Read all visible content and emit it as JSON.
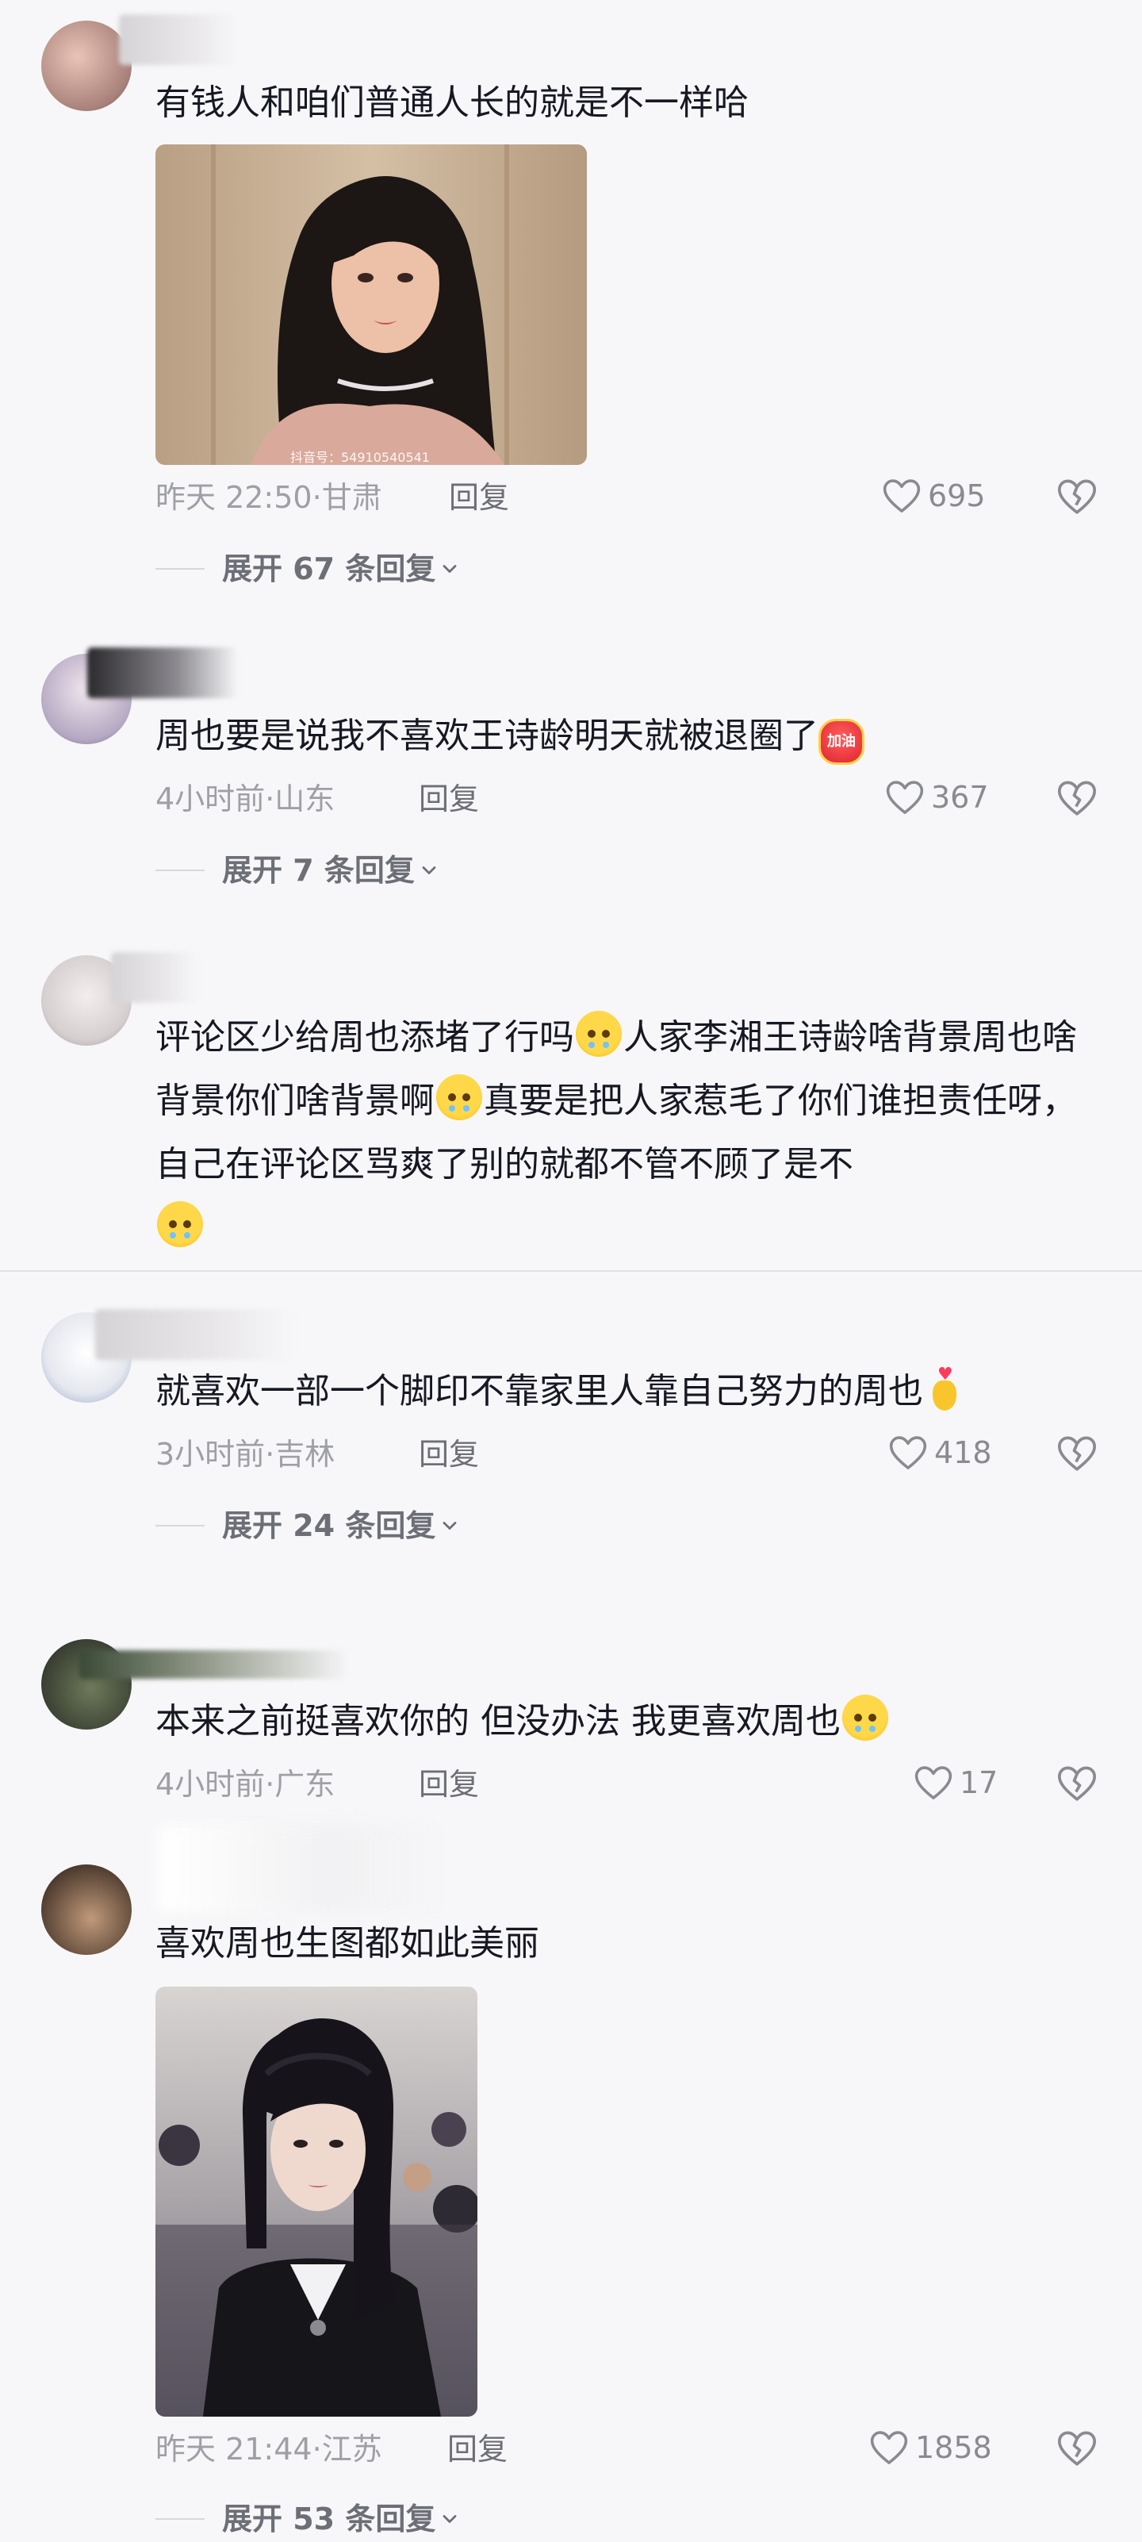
{
  "comments": [
    {
      "text": "有钱人和咱们普通人长的就是不一样哈",
      "time": "昨天 22:50",
      "location": "甘肃",
      "reply_label": "回复",
      "likes": "695",
      "expand": "展开 67 条回复",
      "image_watermark": "抖音号：54910540541"
    },
    {
      "text": "周也要是说我不喜欢王诗龄明天就被退圈了",
      "sticker_label": "加油",
      "time": "4小时前",
      "location": "山东",
      "reply_label": "回复",
      "likes": "367",
      "expand": "展开 7 条回复"
    },
    {
      "text_parts": [
        "评论区少给周也添堵了行吗",
        "人家李湘王诗龄啥背景周也啥背景你们啥背景啊",
        "真要是把人家惹毛了你们谁担责任呀，自己在评论区骂爽了别的就都不管不顾了是不"
      ]
    },
    {
      "text": "就喜欢一部一个脚印不靠家里人靠自己努力的周也",
      "time": "3小时前",
      "location": "吉林",
      "reply_label": "回复",
      "likes": "418",
      "expand": "展开 24 条回复"
    },
    {
      "text": "本来之前挺喜欢你的 但没办法 我更喜欢周也",
      "time": "4小时前",
      "location": "广东",
      "reply_label": "回复",
      "likes": "17"
    },
    {
      "text": "喜欢周也生图都如此美丽",
      "time": "昨天 21:44",
      "location": "江苏",
      "reply_label": "回复",
      "likes": "1858",
      "expand": "展开 53 条回复"
    }
  ],
  "meta_separator": "·",
  "icons": {
    "like": "heart-outline-icon",
    "dislike": "broken-heart-icon",
    "expand": "chevron-down-icon"
  },
  "colors": {
    "background": "#f7f7f9",
    "text": "#161823",
    "meta": "#9fa0a6"
  }
}
